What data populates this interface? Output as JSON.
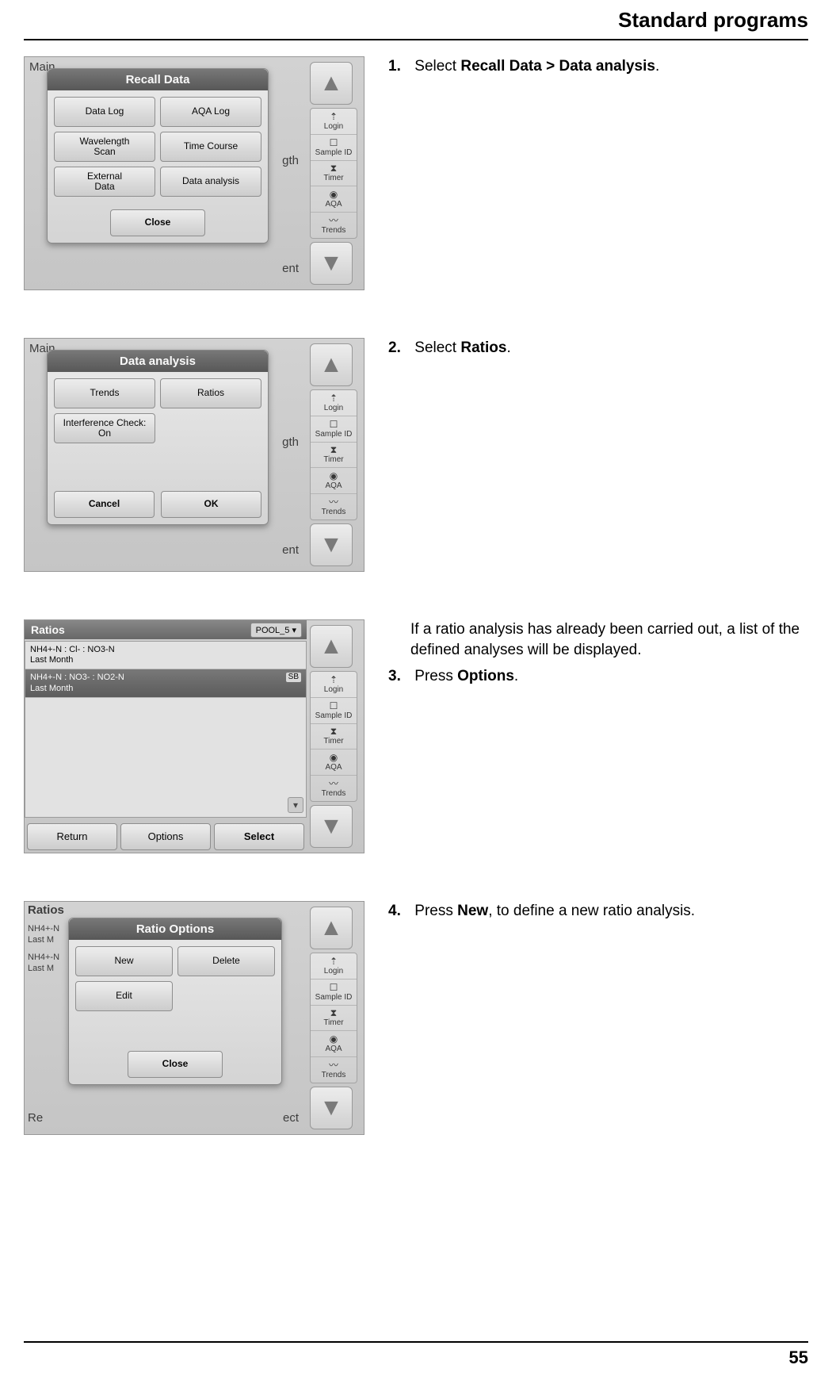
{
  "header": {
    "title": "Standard programs"
  },
  "footer": {
    "page": "55"
  },
  "side_icons": {
    "login": "Login",
    "sample_id": "Sample ID",
    "timer": "Timer",
    "aqa": "AQA",
    "trends": "Trends"
  },
  "screens": {
    "recall_data": {
      "bg": "Main",
      "title": "Recall Data",
      "buttons": {
        "data_log": "Data Log",
        "aqa_log": "AQA Log",
        "wavelength_scan": "Wavelength\nScan",
        "time_course": "Time Course",
        "external_data": "External\nData",
        "data_analysis": "Data analysis"
      },
      "close": "Close",
      "frag_right": "ent",
      "frag_right2": "gth"
    },
    "data_analysis": {
      "bg": "Main",
      "title": "Data analysis",
      "buttons": {
        "trends": "Trends",
        "ratios": "Ratios",
        "interference": "Interference Check:\nOn"
      },
      "cancel": "Cancel",
      "ok": "OK",
      "frag_right": "ent",
      "frag_right2": "gth"
    },
    "ratios_list": {
      "title": "Ratios",
      "pool": "POOL_5",
      "row1_line1": "NH4+-N  :  Cl-  :  NO3-N",
      "row1_line2": "Last Month",
      "row2_line1": "NH4+-N  :  NO3-  :  NO2-N",
      "row2_line2": "Last Month",
      "row2_badge": "SB",
      "return": "Return",
      "options": "Options",
      "select": "Select"
    },
    "ratio_options": {
      "title": "Ratio Options",
      "bg_title": "Ratios",
      "bg_row1": "NH4+-N",
      "bg_row1b": "Last M",
      "bg_row2": "NH4+-N",
      "bg_row2b": "Last M",
      "new_btn": "New",
      "delete_btn": "Delete",
      "edit_btn": "Edit",
      "close": "Close",
      "frag_left": "Re",
      "frag_right": "ect"
    }
  },
  "steps": {
    "s1": {
      "num": "1.",
      "pre": "Select ",
      "bold": "Recall Data > Data analysis",
      "post": "."
    },
    "s2": {
      "num": "2.",
      "pre": "Select ",
      "bold": "Ratios",
      "post": "."
    },
    "s3_intro": "If a ratio analysis has already been carried out, a list of the defined analyses will be displayed.",
    "s3": {
      "num": "3.",
      "pre": "Press ",
      "bold": "Options",
      "post": "."
    },
    "s4": {
      "num": "4.",
      "pre": "Press ",
      "bold": "New",
      "post": ", to define a new ratio analysis."
    }
  }
}
